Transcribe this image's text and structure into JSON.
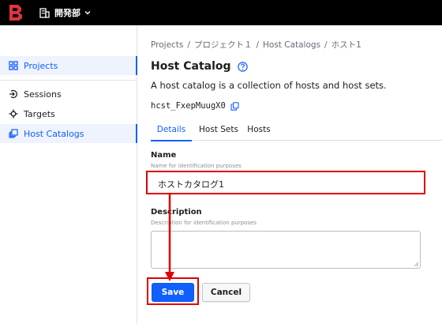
{
  "topbar": {
    "org_name": "開発部",
    "logo_icon": "boundary-logo",
    "org_icon": "building-icon",
    "chevron_icon": "chevron-down-icon"
  },
  "sidebar": {
    "items": [
      {
        "label": "Projects",
        "icon": "grid-icon",
        "active": true
      },
      {
        "label": "Sessions",
        "icon": "sessions-icon",
        "active": false
      },
      {
        "label": "Targets",
        "icon": "target-icon",
        "active": false
      },
      {
        "label": "Host Catalogs",
        "icon": "stack-icon",
        "active": true
      }
    ]
  },
  "breadcrumb": [
    "Projects",
    "プロジェクト１",
    "Host Catalogs",
    "ホスト1"
  ],
  "page": {
    "title": "Host Catalog",
    "subtitle": "A host catalog is a collection of hosts and host sets.",
    "resource_id": "hcst_FxepMuugX0"
  },
  "tabs": [
    {
      "label": "Details",
      "active": true
    },
    {
      "label": "Host Sets",
      "active": false
    },
    {
      "label": "Hosts",
      "active": false
    }
  ],
  "form": {
    "name_label": "Name",
    "name_hint": "Name for identification purposes",
    "name_value": "ホストカタログ1",
    "description_label": "Description",
    "description_hint": "Description for identification purposes",
    "description_value": "",
    "save_label": "Save",
    "cancel_label": "Cancel"
  },
  "colors": {
    "accent": "#1060ff",
    "annotation": "#e00000"
  }
}
